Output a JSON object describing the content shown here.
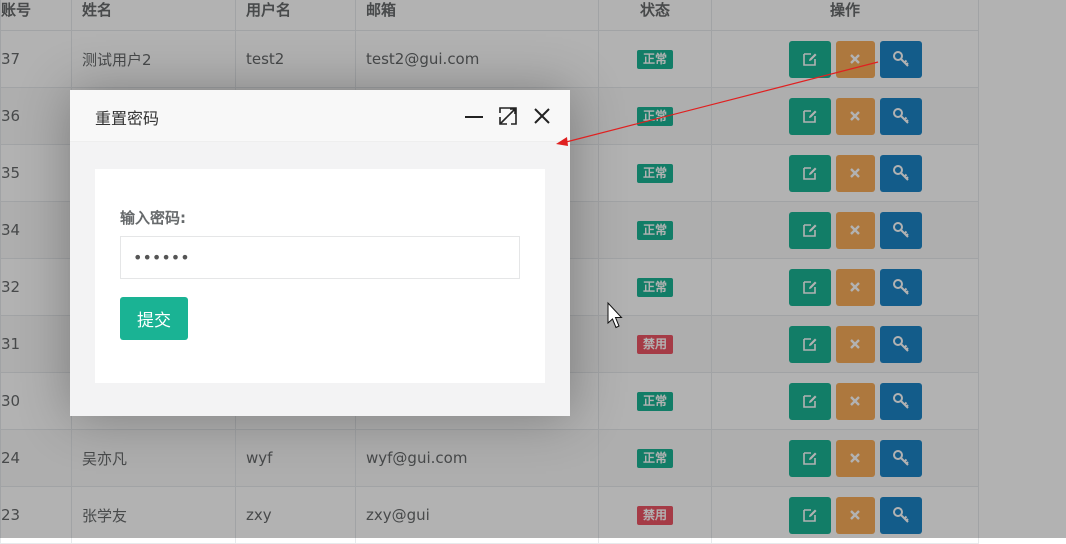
{
  "table": {
    "headers": {
      "id": "账号",
      "name": "姓名",
      "username": "用户名",
      "email": "邮箱",
      "status": "状态",
      "actions": "操作"
    },
    "rows": [
      {
        "id": "37",
        "name": "测试用户2",
        "username": "test2",
        "email": "test2@gui.com",
        "status": "正常",
        "status_color": "#1ab394"
      },
      {
        "id": "36",
        "name": "",
        "username": "",
        "email": "",
        "status": "正常",
        "status_color": "#1ab394"
      },
      {
        "id": "35",
        "name": "",
        "username": "",
        "email": "",
        "status": "正常",
        "status_color": "#1ab394"
      },
      {
        "id": "34",
        "name": "",
        "username": "",
        "email": "",
        "status": "正常",
        "status_color": "#1ab394"
      },
      {
        "id": "32",
        "name": "",
        "username": "",
        "email": "",
        "status": "正常",
        "status_color": "#1ab394"
      },
      {
        "id": "31",
        "name": "",
        "username": "",
        "email": "",
        "status": "禁用",
        "status_color": "#ed5565"
      },
      {
        "id": "30",
        "name": "",
        "username": "",
        "email": "",
        "status": "正常",
        "status_color": "#1ab394"
      },
      {
        "id": "24",
        "name": "吴亦凡",
        "username": "wyf",
        "email": "wyf@gui.com",
        "status": "正常",
        "status_color": "#1ab394"
      },
      {
        "id": "23",
        "name": "张学友",
        "username": "zxy",
        "email": "zxy@gui",
        "status": "禁用",
        "status_color": "#ed5565"
      }
    ],
    "action_icons": [
      "edit-icon",
      "delete-icon",
      "key-icon"
    ]
  },
  "dialog": {
    "title": "重置密码",
    "controls": [
      "minimize-icon",
      "maximize-icon",
      "close-icon"
    ],
    "password_label": "输入密码:",
    "password_value": "••••••",
    "submit_label": "提交"
  },
  "colors": {
    "primary": "#1ab394",
    "warning": "#f8ac59",
    "info": "#1c84c6",
    "danger": "#ed5565",
    "annotation_arrow": "#e02020"
  }
}
